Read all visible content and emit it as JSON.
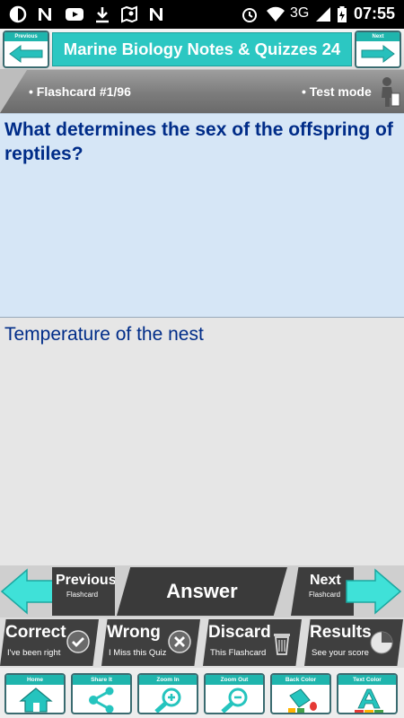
{
  "status_bar": {
    "network": "3G",
    "time": "07:55",
    "icons": [
      "circle-half-icon",
      "n-icon",
      "youtube-icon",
      "download-icon",
      "map-icon",
      "n-icon",
      "alarm-icon",
      "wifi-icon",
      "signal-icon",
      "battery-icon"
    ]
  },
  "header": {
    "title": "Marine Biology Notes & Quizzes 24",
    "prev_label": "Previous",
    "next_label": "Next"
  },
  "info": {
    "flashcard": "• Flashcard #1/96",
    "mode": "• Test mode"
  },
  "question": "What determines the sex of the offspring of reptiles?",
  "answer": "Temperature of the nest",
  "nav": {
    "previous": "Previous",
    "previous_sub": "Flashcard",
    "answer": "Answer",
    "next": "Next",
    "next_sub": "Flashcard"
  },
  "results": [
    {
      "title": "Correct",
      "sub": "I've been right",
      "icon": "check-icon"
    },
    {
      "title": "Wrong",
      "sub": "I Miss this Quiz",
      "icon": "x-icon"
    },
    {
      "title": "Discard",
      "sub": "This Flashcard",
      "icon": "trash-icon"
    },
    {
      "title": "Results",
      "sub": "See your score",
      "icon": "pie-icon"
    }
  ],
  "tools": [
    {
      "label": "Home",
      "icon": "home-icon"
    },
    {
      "label": "Share It",
      "icon": "share-icon"
    },
    {
      "label": "Zoom In",
      "icon": "zoom-in-icon"
    },
    {
      "label": "Zoom Out",
      "icon": "zoom-out-icon"
    },
    {
      "label": "Back Color",
      "icon": "paint-bucket-icon"
    },
    {
      "label": "Text Color",
      "icon": "text-color-icon"
    }
  ],
  "colors": {
    "accent": "#2cc7c2",
    "question_bg": "#d6e6f6",
    "text": "#002c88",
    "dark_button": "#3a3a3a"
  }
}
